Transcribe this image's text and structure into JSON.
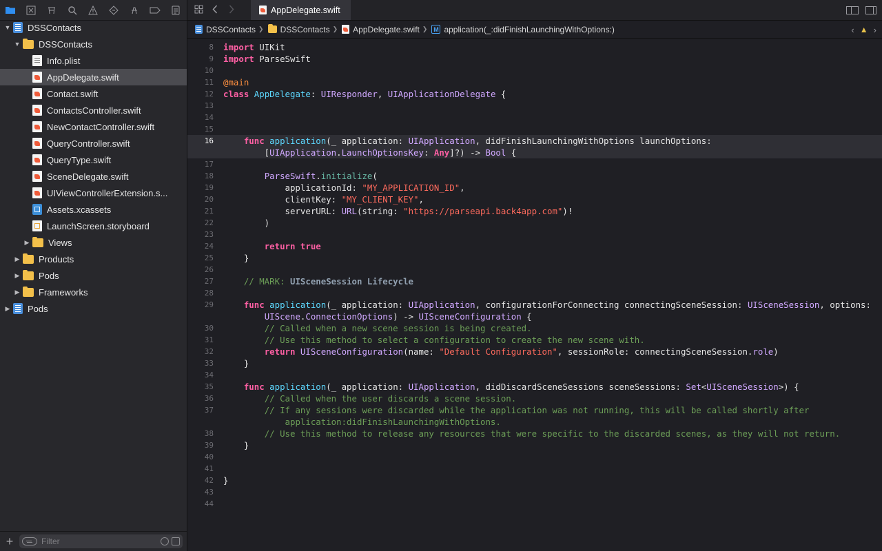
{
  "window": {
    "active_tab": "AppDelegate.swift"
  },
  "navigator": {
    "tree": [
      {
        "label": "DSSContacts",
        "icon": "project-icon",
        "indent": 0,
        "disclosure": "open",
        "selected": false
      },
      {
        "label": "DSSContacts",
        "icon": "folder-icon",
        "indent": 1,
        "disclosure": "open",
        "selected": false
      },
      {
        "label": "Info.plist",
        "icon": "plist-file-icon",
        "indent": 2,
        "disclosure": "none",
        "selected": false
      },
      {
        "label": "AppDelegate.swift",
        "icon": "swift-file-icon",
        "indent": 2,
        "disclosure": "none",
        "selected": true
      },
      {
        "label": "Contact.swift",
        "icon": "swift-file-icon",
        "indent": 2,
        "disclosure": "none",
        "selected": false
      },
      {
        "label": "ContactsController.swift",
        "icon": "swift-file-icon",
        "indent": 2,
        "disclosure": "none",
        "selected": false
      },
      {
        "label": "NewContactController.swift",
        "icon": "swift-file-icon",
        "indent": 2,
        "disclosure": "none",
        "selected": false
      },
      {
        "label": "QueryController.swift",
        "icon": "swift-file-icon",
        "indent": 2,
        "disclosure": "none",
        "selected": false
      },
      {
        "label": "QueryType.swift",
        "icon": "swift-file-icon",
        "indent": 2,
        "disclosure": "none",
        "selected": false
      },
      {
        "label": "SceneDelegate.swift",
        "icon": "swift-file-icon",
        "indent": 2,
        "disclosure": "none",
        "selected": false
      },
      {
        "label": "UIViewControllerExtension.s...",
        "icon": "swift-file-icon",
        "indent": 2,
        "disclosure": "none",
        "selected": false
      },
      {
        "label": "Assets.xcassets",
        "icon": "assets-icon",
        "indent": 2,
        "disclosure": "none",
        "selected": false
      },
      {
        "label": "LaunchScreen.storyboard",
        "icon": "storyboard-icon",
        "indent": 2,
        "disclosure": "none",
        "selected": false
      },
      {
        "label": "Views",
        "icon": "folder-icon",
        "indent": 2,
        "disclosure": "closed",
        "selected": false
      },
      {
        "label": "Products",
        "icon": "folder-icon",
        "indent": 1,
        "disclosure": "closed",
        "selected": false
      },
      {
        "label": "Pods",
        "icon": "folder-icon",
        "indent": 1,
        "disclosure": "closed",
        "selected": false
      },
      {
        "label": "Frameworks",
        "icon": "folder-icon",
        "indent": 1,
        "disclosure": "closed",
        "selected": false
      },
      {
        "label": "Pods",
        "icon": "project-icon",
        "indent": 0,
        "disclosure": "closed",
        "selected": false
      }
    ],
    "filter_placeholder": "Filter",
    "add_label": "+"
  },
  "jump_bar": [
    {
      "label": "DSSContacts",
      "icon": "project-icon"
    },
    {
      "label": "DSSContacts",
      "icon": "folder-icon"
    },
    {
      "label": "AppDelegate.swift",
      "icon": "swift-file-icon"
    },
    {
      "label": "application(_:didFinishLaunchingWithOptions:)",
      "icon": "method-icon",
      "badge": "M"
    }
  ],
  "editor": {
    "current_line": 16,
    "lines": [
      {
        "n": "8",
        "tokens": [
          [
            "k",
            "import"
          ],
          [
            "p",
            " UIKit"
          ]
        ]
      },
      {
        "n": "9",
        "tokens": [
          [
            "k",
            "import"
          ],
          [
            "p",
            " ParseSwift"
          ]
        ]
      },
      {
        "n": "10",
        "tokens": []
      },
      {
        "n": "11",
        "tokens": [
          [
            "at",
            "@main"
          ]
        ]
      },
      {
        "n": "12",
        "tokens": [
          [
            "k",
            "class"
          ],
          [
            "p",
            " "
          ],
          [
            "y",
            "AppDelegate"
          ],
          [
            "p",
            ": "
          ],
          [
            "t",
            "UIResponder"
          ],
          [
            "p",
            ", "
          ],
          [
            "t",
            "UIApplicationDelegate"
          ],
          [
            "p",
            " {"
          ]
        ]
      },
      {
        "n": "13",
        "tokens": []
      },
      {
        "n": "14",
        "tokens": []
      },
      {
        "n": "15",
        "tokens": []
      },
      {
        "n": "16",
        "tokens": [
          [
            "p",
            "    "
          ],
          [
            "k",
            "func"
          ],
          [
            "p",
            " "
          ],
          [
            "y",
            "application"
          ],
          [
            "p",
            "(_ application: "
          ],
          [
            "t",
            "UIApplication"
          ],
          [
            "p",
            ", didFinishLaunchingWithOptions launchOptions:"
          ]
        ]
      },
      {
        "n": "",
        "tokens": [
          [
            "p",
            "        ["
          ],
          [
            "t",
            "UIApplication"
          ],
          [
            "p",
            "."
          ],
          [
            "t",
            "LaunchOptionsKey"
          ],
          [
            "p",
            ": "
          ],
          [
            "k",
            "Any"
          ],
          [
            "p",
            "]?) -> "
          ],
          [
            "t",
            "Bool"
          ],
          [
            "p",
            " {"
          ]
        ]
      },
      {
        "n": "17",
        "tokens": []
      },
      {
        "n": "18",
        "tokens": [
          [
            "p",
            "        "
          ],
          [
            "t",
            "ParseSwift"
          ],
          [
            "p",
            "."
          ],
          [
            "f",
            "initialize"
          ],
          [
            "p",
            "("
          ]
        ]
      },
      {
        "n": "19",
        "tokens": [
          [
            "p",
            "            applicationId: "
          ],
          [
            "s",
            "\"MY_APPLICATION_ID\""
          ],
          [
            "p",
            ","
          ]
        ]
      },
      {
        "n": "20",
        "tokens": [
          [
            "p",
            "            clientKey: "
          ],
          [
            "s",
            "\"MY_CLIENT_KEY\""
          ],
          [
            "p",
            ","
          ]
        ]
      },
      {
        "n": "21",
        "tokens": [
          [
            "p",
            "            serverURL: "
          ],
          [
            "t",
            "URL"
          ],
          [
            "p",
            "(string: "
          ],
          [
            "s",
            "\"https://parseapi.back4app.com\""
          ],
          [
            "p",
            ")!"
          ]
        ]
      },
      {
        "n": "22",
        "tokens": [
          [
            "p",
            "        )"
          ]
        ]
      },
      {
        "n": "23",
        "tokens": []
      },
      {
        "n": "24",
        "tokens": [
          [
            "p",
            "        "
          ],
          [
            "k",
            "return"
          ],
          [
            "p",
            " "
          ],
          [
            "k",
            "true"
          ]
        ]
      },
      {
        "n": "25",
        "tokens": [
          [
            "p",
            "    }"
          ]
        ]
      },
      {
        "n": "26",
        "tokens": []
      },
      {
        "n": "27",
        "tokens": [
          [
            "p",
            "    "
          ],
          [
            "c",
            "// MARK: "
          ],
          [
            "mk",
            "UISceneSession Lifecycle"
          ]
        ]
      },
      {
        "n": "28",
        "tokens": []
      },
      {
        "n": "29",
        "tokens": [
          [
            "p",
            "    "
          ],
          [
            "k",
            "func"
          ],
          [
            "p",
            " "
          ],
          [
            "y",
            "application"
          ],
          [
            "p",
            "(_ application: "
          ],
          [
            "t",
            "UIApplication"
          ],
          [
            "p",
            ", configurationForConnecting connectingSceneSession: "
          ],
          [
            "t",
            "UISceneSession"
          ],
          [
            "p",
            ", options:"
          ]
        ]
      },
      {
        "n": "",
        "tokens": [
          [
            "p",
            "        "
          ],
          [
            "t",
            "UIScene"
          ],
          [
            "p",
            "."
          ],
          [
            "t",
            "ConnectionOptions"
          ],
          [
            "p",
            ") -> "
          ],
          [
            "t",
            "UISceneConfiguration"
          ],
          [
            "p",
            " {"
          ]
        ]
      },
      {
        "n": "30",
        "tokens": [
          [
            "p",
            "        "
          ],
          [
            "c",
            "// Called when a new scene session is being created."
          ]
        ]
      },
      {
        "n": "31",
        "tokens": [
          [
            "p",
            "        "
          ],
          [
            "c",
            "// Use this method to select a configuration to create the new scene with."
          ]
        ]
      },
      {
        "n": "32",
        "tokens": [
          [
            "p",
            "        "
          ],
          [
            "k",
            "return"
          ],
          [
            "p",
            " "
          ],
          [
            "t",
            "UISceneConfiguration"
          ],
          [
            "p",
            "(name: "
          ],
          [
            "s",
            "\"Default Configuration\""
          ],
          [
            "p",
            ", sessionRole: connectingSceneSession."
          ],
          [
            "t",
            "role"
          ],
          [
            "p",
            ")"
          ]
        ]
      },
      {
        "n": "33",
        "tokens": [
          [
            "p",
            "    }"
          ]
        ]
      },
      {
        "n": "34",
        "tokens": []
      },
      {
        "n": "35",
        "tokens": [
          [
            "p",
            "    "
          ],
          [
            "k",
            "func"
          ],
          [
            "p",
            " "
          ],
          [
            "y",
            "application"
          ],
          [
            "p",
            "(_ application: "
          ],
          [
            "t",
            "UIApplication"
          ],
          [
            "p",
            ", didDiscardSceneSessions sceneSessions: "
          ],
          [
            "t",
            "Set"
          ],
          [
            "p",
            "<"
          ],
          [
            "t",
            "UISceneSession"
          ],
          [
            "p",
            ">) {"
          ]
        ]
      },
      {
        "n": "36",
        "tokens": [
          [
            "p",
            "        "
          ],
          [
            "c",
            "// Called when the user discards a scene session."
          ]
        ]
      },
      {
        "n": "37",
        "tokens": [
          [
            "p",
            "        "
          ],
          [
            "c",
            "// If any sessions were discarded while the application was not running, this will be called shortly after"
          ]
        ]
      },
      {
        "n": "",
        "tokens": [
          [
            "p",
            "            "
          ],
          [
            "c",
            "application:didFinishLaunchingWithOptions."
          ]
        ]
      },
      {
        "n": "38",
        "tokens": [
          [
            "p",
            "        "
          ],
          [
            "c",
            "// Use this method to release any resources that were specific to the discarded scenes, as they will not return."
          ]
        ]
      },
      {
        "n": "39",
        "tokens": [
          [
            "p",
            "    }"
          ]
        ]
      },
      {
        "n": "40",
        "tokens": []
      },
      {
        "n": "41",
        "tokens": []
      },
      {
        "n": "42",
        "tokens": [
          [
            "p",
            "}"
          ]
        ]
      },
      {
        "n": "43",
        "tokens": []
      },
      {
        "n": "44",
        "tokens": []
      }
    ]
  }
}
